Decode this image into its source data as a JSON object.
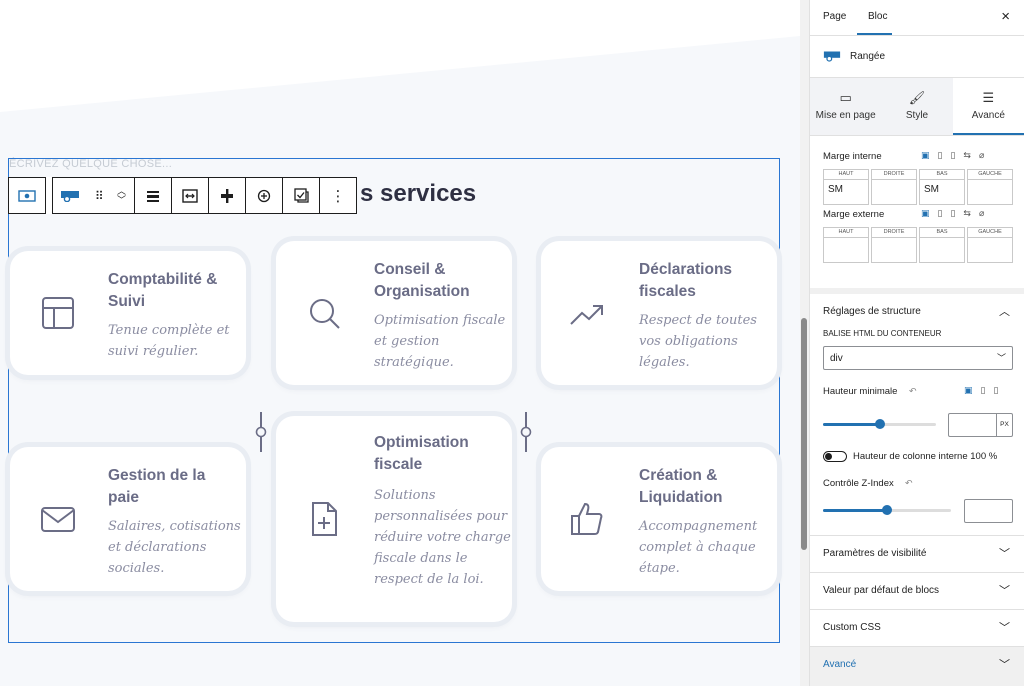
{
  "editor": {
    "placeholder": "ÉCRIVEZ QUELQUE CHOSE...",
    "section_title": "s services"
  },
  "cards": [
    {
      "title": [
        "Comptabilité &",
        "Suivi"
      ],
      "desc": [
        "Tenue complète et",
        "suivi régulier."
      ],
      "icon": "layout-icon"
    },
    {
      "title": [
        "Conseil &",
        "Organisation"
      ],
      "desc": [
        "Optimisation fiscale",
        "et gestion",
        "stratégique."
      ],
      "icon": "search-icon"
    },
    {
      "title": [
        "Déclarations",
        "fiscales"
      ],
      "desc": [
        "Respect de toutes",
        "vos obligations",
        "légales."
      ],
      "icon": "trending-up-icon"
    },
    {
      "title": [
        "Gestion de la",
        "paie"
      ],
      "desc": [
        "Salaires, cotisations",
        "et déclarations",
        "sociales."
      ],
      "icon": "mail-icon"
    },
    {
      "title": [
        "Optimisation",
        "fiscale"
      ],
      "desc": [
        "Solutions",
        "personnalisées pour",
        "réduire votre charge",
        "fiscale dans le",
        "respect de la loi."
      ],
      "icon": "file-plus-icon"
    },
    {
      "title": [
        "Création &",
        "Liquidation"
      ],
      "desc": [
        "Accompagnement",
        "complet à chaque",
        "étape."
      ],
      "icon": "thumbs-up-icon"
    }
  ],
  "sidebar": {
    "tabs": {
      "page": "Page",
      "bloc": "Bloc"
    },
    "close": "×",
    "block_name": "Rangée",
    "sub_tabs": {
      "layout": "Mise en page",
      "style": "Style",
      "advanced": "Avancé"
    },
    "padding": {
      "label": "Marge interne",
      "sides": [
        "HAUT",
        "DROITE",
        "BAS",
        "GAUCHE"
      ],
      "values": [
        "SM",
        "",
        "SM",
        ""
      ]
    },
    "margin": {
      "label": "Marge externe",
      "sides": [
        "HAUT",
        "DROITE",
        "BAS",
        "GAUCHE"
      ],
      "values": [
        "",
        "",
        "",
        ""
      ]
    },
    "structure": {
      "title": "Réglages de structure",
      "html_tag_label": "BALISE HTML DU CONTENEUR",
      "html_tag_value": "div",
      "min_height_label": "Hauteur minimale",
      "min_height_unit": "PX",
      "min_height_value": "",
      "inner_height_label": "Hauteur de colonne interne 100 %",
      "inner_height_enabled": false,
      "zindex_label": "Contrôle Z-Index",
      "zindex_value": ""
    },
    "panels": {
      "visibility": "Paramètres de visibilité",
      "defaults": "Valeur par défaut de blocs",
      "css": "Custom CSS",
      "advanced": "Avancé"
    }
  },
  "colors": {
    "accent": "#2271b1",
    "block_border": "#2a76d2",
    "card_title": "#6a6c86",
    "card_icon": "#6b6d86"
  }
}
